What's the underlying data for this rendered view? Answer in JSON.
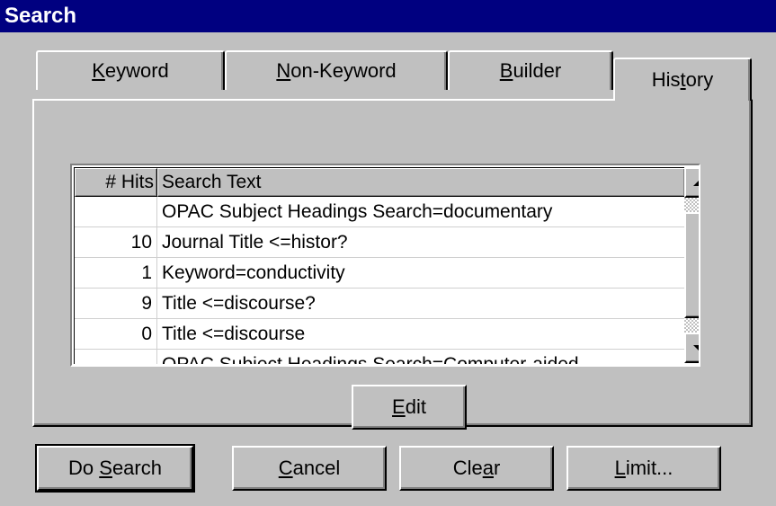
{
  "window": {
    "title": "Search"
  },
  "tabs": [
    {
      "pre": "",
      "key": "K",
      "post": "eyword",
      "active": false
    },
    {
      "pre": "",
      "key": "N",
      "post": "on-Keyword",
      "active": false
    },
    {
      "pre": "",
      "key": "B",
      "post": "uilder",
      "active": false
    },
    {
      "pre": "His",
      "key": "t",
      "post": "ory",
      "active": true
    }
  ],
  "history_list": {
    "columns": {
      "hits": "# Hits",
      "text": "Search Text"
    },
    "rows": [
      {
        "hits": "",
        "text": "OPAC Subject Headings Search=documentary"
      },
      {
        "hits": "10",
        "text": "Journal Title <=histor?"
      },
      {
        "hits": "1",
        "text": "Keyword=conductivity"
      },
      {
        "hits": "9",
        "text": "Title <=discourse?"
      },
      {
        "hits": "0",
        "text": "Title <=discourse"
      },
      {
        "hits": "",
        "text": "OPAC Subject Headings Search=Computer-aided"
      }
    ]
  },
  "edit_button": {
    "pre": "",
    "key": "E",
    "post": "dit"
  },
  "buttons": {
    "do_search": {
      "pre": "Do ",
      "key": "S",
      "post": "earch"
    },
    "cancel": {
      "pre": "",
      "key": "C",
      "post": "ancel"
    },
    "clear": {
      "pre": "Cle",
      "key": "a",
      "post": "r"
    },
    "limit": {
      "pre": "",
      "key": "L",
      "post": "imit..."
    }
  },
  "colors": {
    "titlebar": "#000080",
    "face": "#c0c0c0",
    "list_bg": "#ffffff"
  }
}
